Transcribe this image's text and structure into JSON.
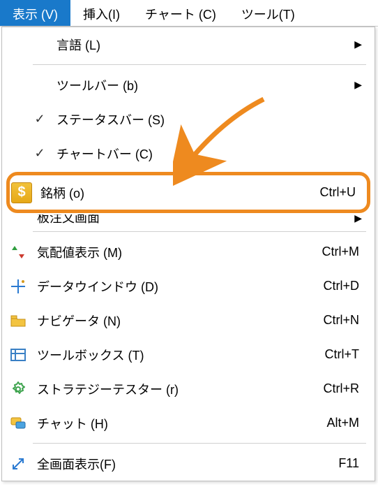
{
  "menubar": {
    "view": "表示 (V)",
    "insert": "挿入(I)",
    "chart": "チャート (C)",
    "tool": "ツール(T)"
  },
  "menu": {
    "language": {
      "label": "言語 (L)"
    },
    "toolbar": {
      "label": "ツールバー (b)"
    },
    "statusbar": {
      "label": "ステータスバー (S)",
      "checked": true
    },
    "chartbar": {
      "label": "チャートバー (C)",
      "checked": true
    },
    "symbols": {
      "label": "銘柄 (o)",
      "shortcut": "Ctrl+U"
    },
    "obscured": {
      "label": "板注文画面"
    },
    "market_watch": {
      "label": "気配値表示 (M)",
      "shortcut": "Ctrl+M"
    },
    "data_window": {
      "label": "データウインドウ (D)",
      "shortcut": "Ctrl+D"
    },
    "navigator": {
      "label": "ナビゲータ (N)",
      "shortcut": "Ctrl+N"
    },
    "toolbox": {
      "label": "ツールボックス (T)",
      "shortcut": "Ctrl+T"
    },
    "strategy_tester": {
      "label": "ストラテジーテスター (r)",
      "shortcut": "Ctrl+R"
    },
    "chat": {
      "label": "チャット (H)",
      "shortcut": "Alt+M"
    },
    "fullscreen": {
      "label": "全画面表示(F)",
      "shortcut": "F11"
    }
  }
}
